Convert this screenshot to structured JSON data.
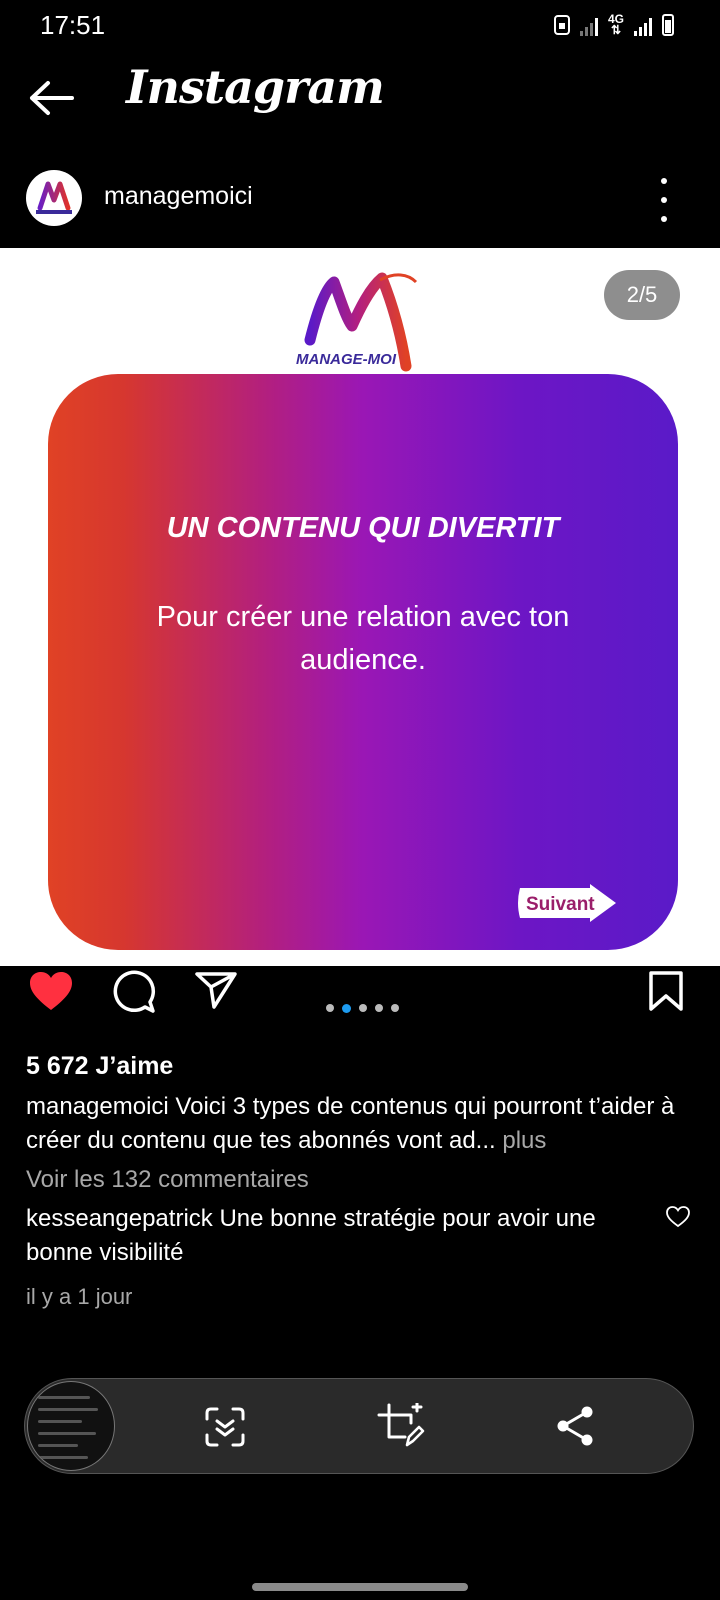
{
  "status_bar": {
    "time": "17:51",
    "network": "4G"
  },
  "header": {
    "app_title": "Instagram"
  },
  "post": {
    "username": "managemoici",
    "slide_counter": "2/5",
    "slide": {
      "brand_text": "MANAGE-MOI",
      "heading": "UN CONTENU QUI DIVERTIT",
      "body": "Pour créer une relation avec ton audience.",
      "next_label": "Suivant"
    },
    "carousel": {
      "total": 5,
      "current": 2
    },
    "likes": "5 672 J’aime",
    "caption": {
      "username": "managemoici",
      "text": "Voici 3 types de contenus qui pourront t’aider à créer du contenu que tes abonnés vont ad...",
      "more": "plus"
    },
    "view_comments": "Voir les 132 commentaires",
    "top_comment": {
      "username": "kesseangepatrick",
      "text": "Une bonne stratégie pour avoir une bonne visibilité"
    },
    "time_ago": "il y a 1 jour",
    "liked": true
  },
  "icons": {
    "back": "arrow-left-icon",
    "more": "more-vertical-icon",
    "like": "heart-icon",
    "comment": "comment-icon",
    "share": "send-icon",
    "save": "bookmark-icon",
    "scan": "scan-text-icon",
    "edit": "crop-edit-icon",
    "share_android": "share-icon"
  },
  "colors": {
    "like_red": "#ff3040",
    "dot_active": "#1d9bf0",
    "gradient_start": "#e04225",
    "gradient_end": "#5a1ac8"
  }
}
